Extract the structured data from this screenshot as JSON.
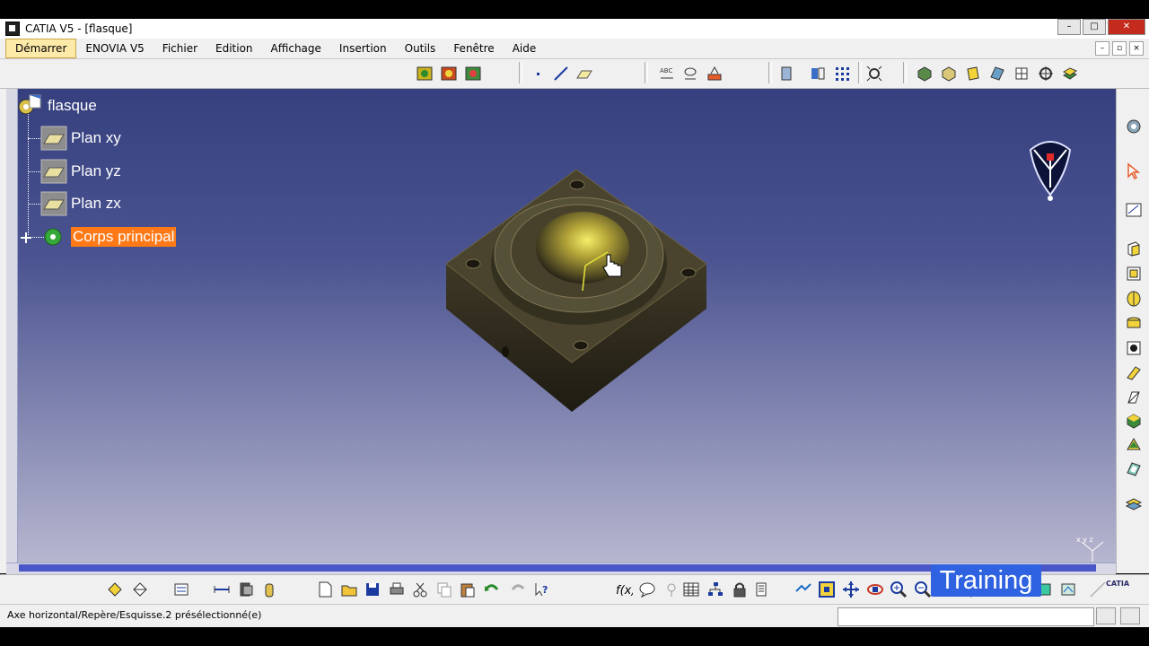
{
  "window": {
    "title": "CATIA V5 - [flasque]",
    "min": "–",
    "max": "□",
    "close": "✕"
  },
  "menu": {
    "items": [
      "Démarrer",
      "ENOVIA V5",
      "Fichier",
      "Edition",
      "Affichage",
      "Insertion",
      "Outils",
      "Fenêtre",
      "Aide"
    ],
    "mdi": [
      "–",
      "▫",
      "×"
    ]
  },
  "tree": {
    "root": "flasque",
    "children": [
      {
        "label": "Plan xy"
      },
      {
        "label": "Plan yz"
      },
      {
        "label": "Plan zx"
      },
      {
        "label": "Corps principal",
        "selected": true
      }
    ]
  },
  "compass_axes": "x y z",
  "status": {
    "text": "Axe horizontal/Repère/Esquisse.2 présélectionné(e)",
    "input": ""
  },
  "overlay": {
    "training": "Training",
    "brand": "CATIA"
  },
  "colors": {
    "selection": "#ff7a17",
    "viewport_top": "#36407e",
    "viewport_bottom": "#bbbad2",
    "part": "#3b3522",
    "highlight": "#e5e23a"
  },
  "icons": {
    "top_toolbar": [
      "sketch-icon",
      "sketch-positioned-icon",
      "sketch-icon",
      "point-icon",
      "line-icon",
      "plane-icon",
      "constraint-icon",
      "parameter-icon",
      "measure-icon",
      "apply-material-icon",
      "rotation-icon",
      "grid-icon",
      "view-icon",
      "shading-icon",
      "shading-edges-icon",
      "shading-box-icon",
      "pad-icon",
      "axis-icon",
      "target-icon",
      "surface-icon"
    ],
    "right_toolbar": [
      "settings-icon",
      "cursor-icon",
      "sketch-icon",
      "pad-icon",
      "pocket-icon",
      "shaft-icon",
      "hole-icon",
      "rib-icon",
      "slot-icon",
      "solid-icon",
      "fillet-icon",
      "draft-icon",
      "shell-icon",
      "thickness-icon"
    ],
    "bottom_toolbar": [
      "part-icon",
      "product-icon",
      "update-icon",
      "measure-icon",
      "analysis-icon",
      "material-icon",
      "new-icon",
      "open-icon",
      "save-icon",
      "print-icon",
      "cut-icon",
      "copy-icon",
      "paste-icon",
      "undo-icon",
      "redo-icon",
      "whats-this-icon",
      "formula-icon",
      "comment-icon",
      "knowledge-icon",
      "table-icon",
      "tree-icon",
      "lock-icon",
      "catalog-icon",
      "fly-icon",
      "fit-all-icon",
      "pan-icon",
      "rotate-icon",
      "zoom-in-icon",
      "zoom-out-icon",
      "normal-view-icon",
      "iso-view-icon",
      "shading-icon",
      "hide-icon",
      "swap-icon"
    ]
  }
}
